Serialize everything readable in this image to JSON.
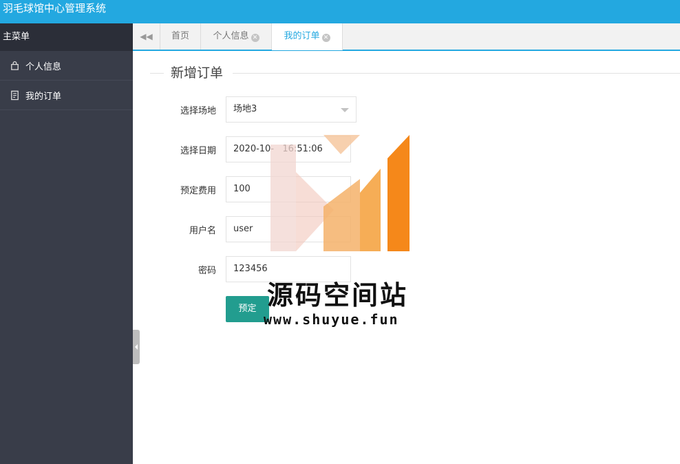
{
  "app": {
    "title": "羽毛球馆中心管理系统"
  },
  "sidebar": {
    "header": "主菜单",
    "items": [
      {
        "label": "个人信息",
        "icon": "bag-icon"
      },
      {
        "label": "我的订单",
        "icon": "document-icon"
      }
    ]
  },
  "tabs": [
    {
      "label": "首页"
    },
    {
      "label": "个人信息"
    },
    {
      "label": "我的订单",
      "active": true
    }
  ],
  "form": {
    "legend": "新增订单",
    "venue": {
      "label": "选择场地",
      "value": "场地3"
    },
    "date": {
      "label": "选择日期",
      "value": "2020-10-   16:51:06"
    },
    "fee": {
      "label": "预定费用",
      "value": "100"
    },
    "username": {
      "label": "用户名",
      "value": "user"
    },
    "password": {
      "label": "密码",
      "value": "123456"
    },
    "submit_label": "预定"
  },
  "watermark": {
    "text": "源码空间站",
    "url": "www.shuyue.fun"
  },
  "colors": {
    "topbar": "#23a8e0",
    "sidebar": "#393d49",
    "button": "#229d8f",
    "accent_tab": "#23a8e0"
  }
}
